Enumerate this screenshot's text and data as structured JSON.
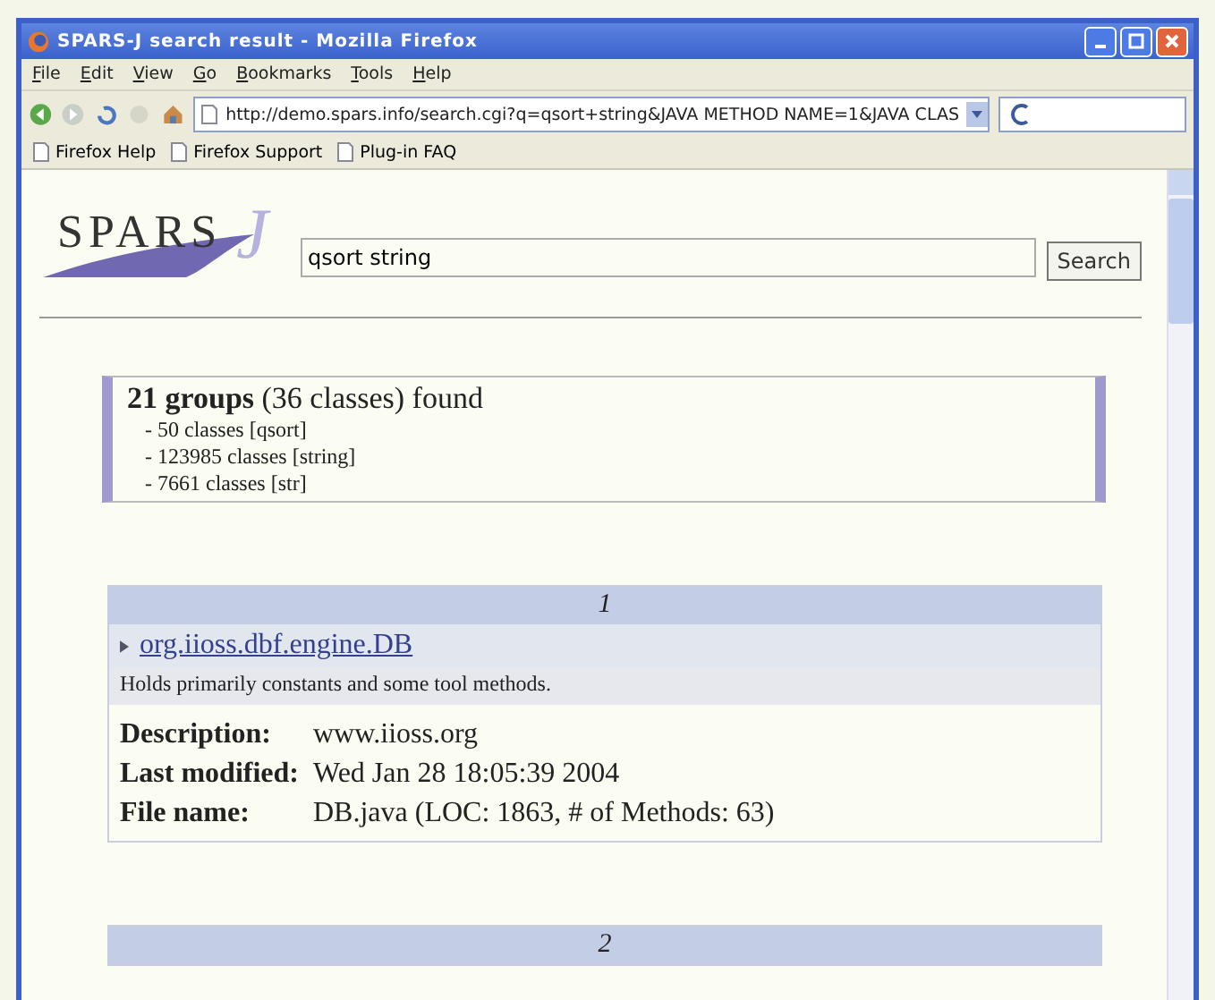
{
  "window": {
    "title": "SPARS-J search result - Mozilla Firefox"
  },
  "menu": [
    "File",
    "Edit",
    "View",
    "Go",
    "Bookmarks",
    "Tools",
    "Help"
  ],
  "address": {
    "value": "http://demo.spars.info/search.cgi?q=qsort+string&JAVA METHOD NAME=1&JAVA CLAS"
  },
  "bookmarks": [
    "Firefox Help",
    "Firefox Support",
    "Plug-in FAQ"
  ],
  "logo": {
    "text": "SPARS",
    "mark": "J"
  },
  "search": {
    "value": "qsort string",
    "button": "Search"
  },
  "summary": {
    "headline": "**21 groups** (36 classes) found",
    "lines": [
      "- 50 classes [qsort]",
      "- 123985 classes [string]",
      "- 7661 classes [str]"
    ]
  },
  "results": [
    {
      "number": "1",
      "name": "org.iioss.dbf.engine.DB",
      "summary": "Holds primarily constants and some tool methods.",
      "fields": [
        {
          "label": "Description:",
          "value": "www.iioss.org"
        },
        {
          "label": "Last modified:",
          "value": "Wed Jan 28 18:05:39 2004"
        },
        {
          "label": "File name:",
          "value": "DB.java (LOC: 1863, # of Methods: 63)"
        }
      ]
    },
    {
      "number": "2"
    }
  ]
}
